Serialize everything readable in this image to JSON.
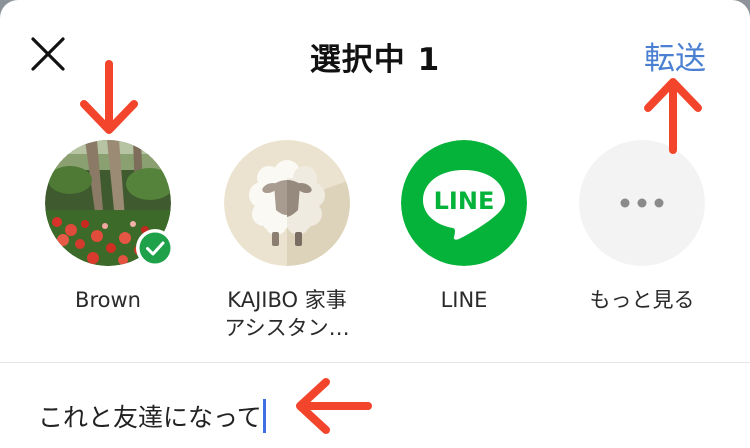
{
  "header": {
    "close_icon": "close-icon",
    "title": "選択中 1",
    "forward_label": "転送",
    "accent_color": "#4a7fd1"
  },
  "recipients": [
    {
      "name": "Brown",
      "avatar": "garden-photo",
      "selected": true
    },
    {
      "name": "KAJIBO 家事\nアシスタン…",
      "avatar": "sheep-icon",
      "selected": false
    },
    {
      "name": "LINE",
      "avatar": "line-logo",
      "selected": false,
      "logo_text": "LINE"
    },
    {
      "name": "もっと見る",
      "avatar": "more-icon",
      "selected": false
    }
  ],
  "message": {
    "value": "これと友達になって"
  },
  "annotations": {
    "color": "#f2452b",
    "arrows": [
      "arrow-down",
      "arrow-up",
      "arrow-left"
    ]
  }
}
